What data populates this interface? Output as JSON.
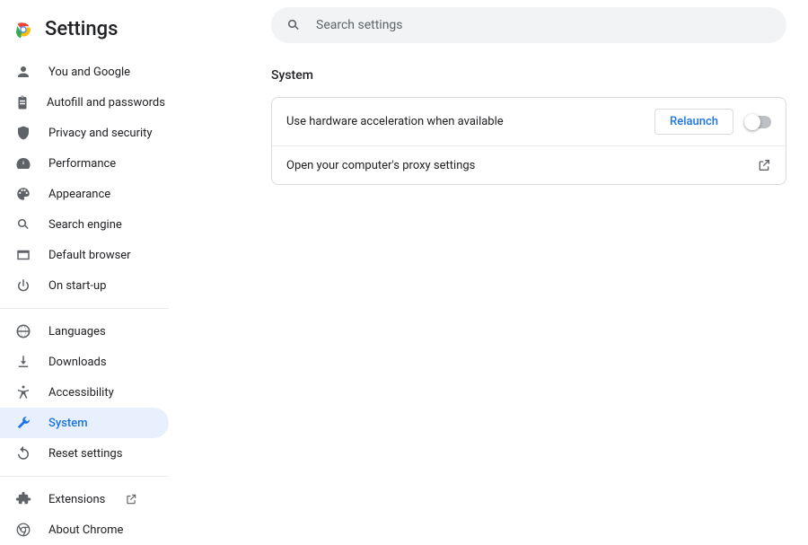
{
  "header": {
    "title": "Settings",
    "search_placeholder": "Search settings"
  },
  "sidebar": {
    "group1": [
      {
        "label": "You and Google"
      },
      {
        "label": "Autofill and passwords"
      },
      {
        "label": "Privacy and security"
      },
      {
        "label": "Performance"
      },
      {
        "label": "Appearance"
      },
      {
        "label": "Search engine"
      },
      {
        "label": "Default browser"
      },
      {
        "label": "On start-up"
      }
    ],
    "group2": [
      {
        "label": "Languages"
      },
      {
        "label": "Downloads"
      },
      {
        "label": "Accessibility"
      },
      {
        "label": "System"
      },
      {
        "label": "Reset settings"
      }
    ],
    "group3": [
      {
        "label": "Extensions"
      },
      {
        "label": "About Chrome"
      }
    ]
  },
  "section": {
    "title": "System",
    "rows": [
      {
        "label": "Use hardware acceleration when available",
        "relaunch": "Relaunch"
      },
      {
        "label": "Open your computer's proxy settings"
      }
    ]
  }
}
